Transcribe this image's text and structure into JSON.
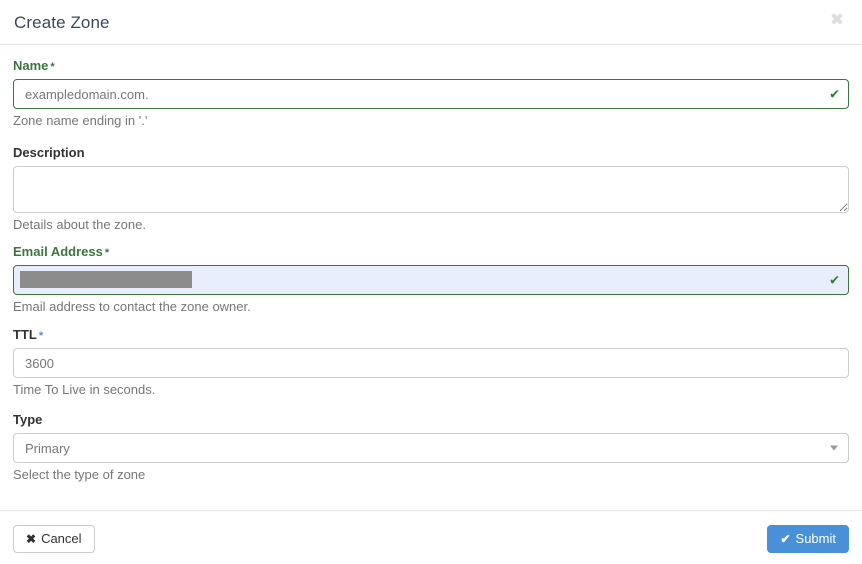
{
  "dialog": {
    "title": "Create Zone",
    "close_icon": "close-x-icon"
  },
  "fields": {
    "name": {
      "label": "Name",
      "required_marker": "*",
      "value": "exampledomain.com.",
      "placeholder": "exampledomain.com.",
      "help": "Zone name ending in '.'",
      "state": "valid",
      "valid_icon": "check-icon"
    },
    "description": {
      "label": "Description",
      "value": "",
      "placeholder": "",
      "help": "Details about the zone.",
      "state": "default"
    },
    "email": {
      "label": "Email Address",
      "required_marker": "*",
      "value": "",
      "placeholder": "",
      "help": "Email address to contact the zone owner.",
      "state": "valid-autofill",
      "valid_icon": "check-icon",
      "redacted": true
    },
    "ttl": {
      "label": "TTL",
      "required_marker": "*",
      "value": "3600",
      "placeholder": "3600",
      "help": "Time To Live in seconds.",
      "state": "default"
    },
    "type": {
      "label": "Type",
      "value": "Primary",
      "options": [
        "Primary"
      ],
      "help": "Select the type of zone",
      "caret_icon": "chevron-down-icon"
    }
  },
  "footer": {
    "cancel_label": "Cancel",
    "cancel_glyph": "✖",
    "submit_label": "Submit",
    "submit_glyph": "✔"
  },
  "colors": {
    "valid_green": "#3c763d",
    "required_blue": "#4a90d9",
    "submit_blue": "#4a90d9",
    "autofill_bg": "#e8eefb",
    "redaction_grey": "#8c8c8c",
    "help_grey": "#777777"
  }
}
